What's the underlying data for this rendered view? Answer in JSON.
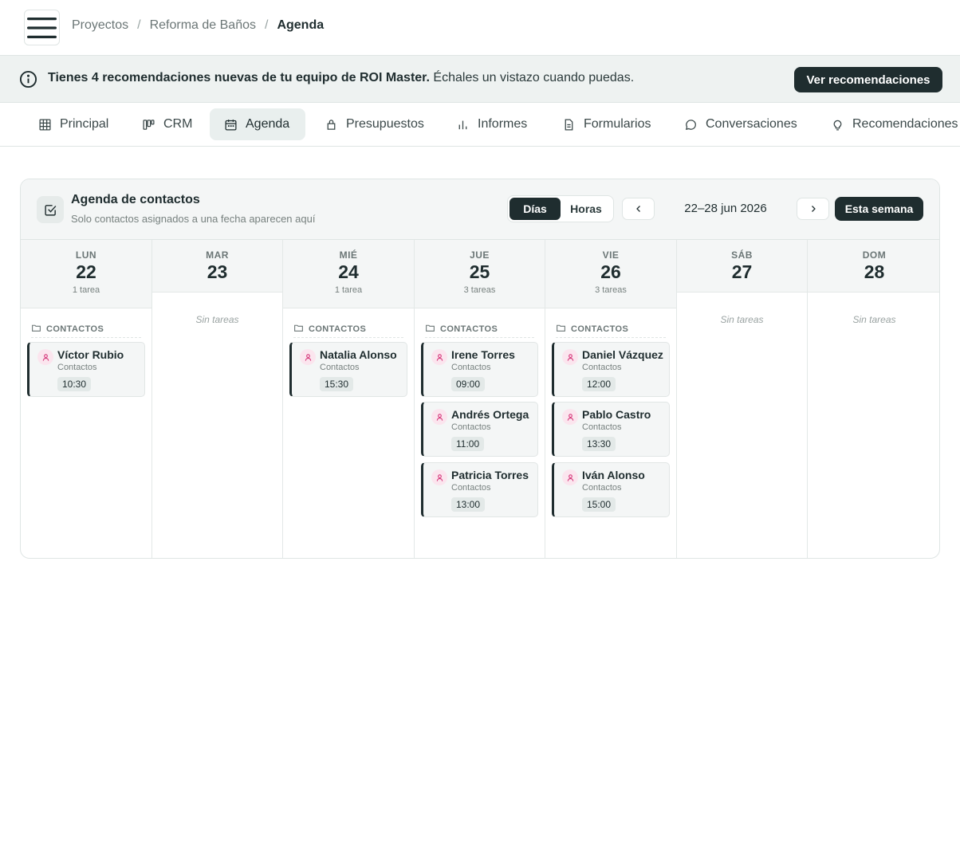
{
  "breadcrumb": {
    "items": [
      "Proyectos",
      "Reforma de Baños"
    ],
    "current": "Agenda",
    "separator": "/"
  },
  "banner": {
    "bold_text": "Tienes 4 recomendaciones nuevas de tu equipo de ROI Master.",
    "text": " Échales un vistazo cuando puedas.",
    "button_label": "Ver recomendaciones"
  },
  "tabs": [
    {
      "label": "Principal",
      "icon": "grid-icon"
    },
    {
      "label": "CRM",
      "icon": "kanban-icon"
    },
    {
      "label": "Agenda",
      "icon": "calendar-icon",
      "active": true
    },
    {
      "label": "Presupuestos",
      "icon": "bag-icon"
    },
    {
      "label": "Informes",
      "icon": "bar-chart-icon"
    },
    {
      "label": "Formularios",
      "icon": "document-icon"
    },
    {
      "label": "Conversaciones",
      "icon": "chat-icon"
    },
    {
      "label": "Recomendaciones",
      "icon": "lightbulb-icon"
    }
  ],
  "agenda": {
    "title": "Agenda de contactos",
    "subtitle": "Solo contactos asignados a una fecha aparecen aquí",
    "view_days": "Días",
    "view_hours": "Horas",
    "active_view": "Días",
    "range": "22–28 jun 2026",
    "this_week_label": "Esta semana",
    "group_label": "CONTACTOS",
    "empty_label": "Sin tareas",
    "days": [
      {
        "dow": "LUN",
        "num": "22",
        "count": "1 tarea",
        "tasks": [
          {
            "name": "Víctor Rubio",
            "sub": "Contactos",
            "time": "10:30"
          }
        ]
      },
      {
        "dow": "MAR",
        "num": "23",
        "count": "",
        "tasks": []
      },
      {
        "dow": "MIÉ",
        "num": "24",
        "count": "1 tarea",
        "tasks": [
          {
            "name": "Natalia Alonso",
            "sub": "Contactos",
            "time": "15:30"
          }
        ]
      },
      {
        "dow": "JUE",
        "num": "25",
        "count": "3 tareas",
        "tasks": [
          {
            "name": "Irene Torres",
            "sub": "Contactos",
            "time": "09:00"
          },
          {
            "name": "Andrés Ortega",
            "sub": "Contactos",
            "time": "11:00"
          },
          {
            "name": "Patricia Torres",
            "sub": "Contactos",
            "time": "13:00"
          }
        ]
      },
      {
        "dow": "VIE",
        "num": "26",
        "count": "3 tareas",
        "tasks": [
          {
            "name": "Daniel Vázquez",
            "sub": "Contactos",
            "time": "12:00"
          },
          {
            "name": "Pablo Castro",
            "sub": "Contactos",
            "time": "13:30"
          },
          {
            "name": "Iván Alonso",
            "sub": "Contactos",
            "time": "15:00"
          }
        ]
      },
      {
        "dow": "SÁB",
        "num": "27",
        "count": "",
        "tasks": []
      },
      {
        "dow": "DOM",
        "num": "28",
        "count": "",
        "tasks": []
      }
    ]
  },
  "colors": {
    "primary": "#1f2d2f",
    "contact_icon_bg": "#fbe5ee",
    "contact_icon": "#d63a7c"
  }
}
